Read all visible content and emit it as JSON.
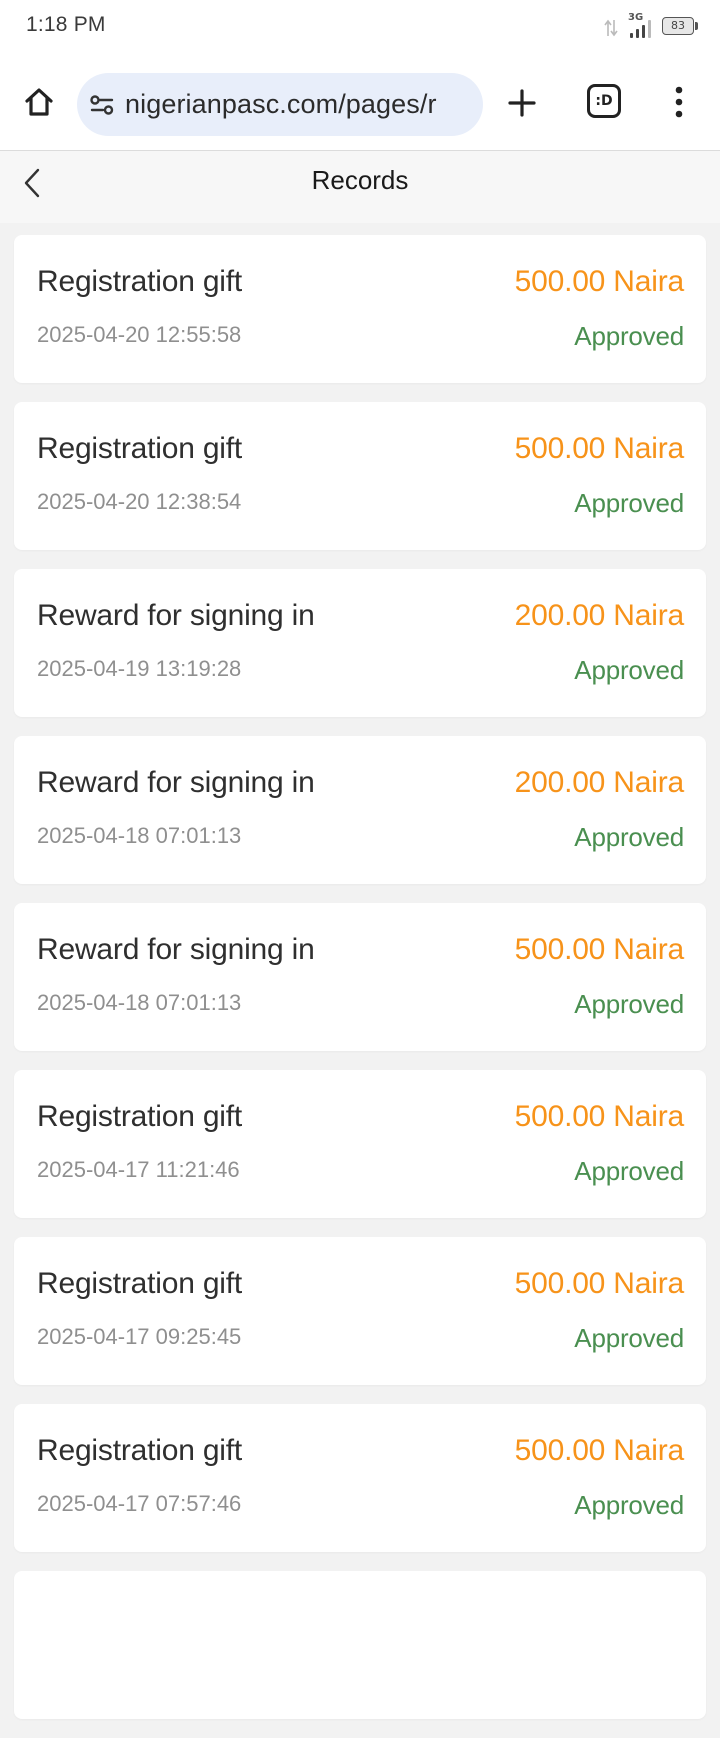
{
  "status_bar": {
    "time": "1:18 PM",
    "network_type": "3G",
    "battery": "83"
  },
  "browser": {
    "url": "nigerianpasc.com/pages/r",
    "tabs_label": ":D"
  },
  "page": {
    "title": "Records"
  },
  "colors": {
    "amount": "#f7931a",
    "approved": "#4a8f50",
    "url_pill": "#e8eefa"
  },
  "records": [
    {
      "title": "Registration gift",
      "time": "2025-04-20 12:55:58",
      "amount": "500.00 Naira",
      "status": "Approved"
    },
    {
      "title": "Registration gift",
      "time": "2025-04-20 12:38:54",
      "amount": "500.00 Naira",
      "status": "Approved"
    },
    {
      "title": "Reward for signing in",
      "time": "2025-04-19 13:19:28",
      "amount": "200.00 Naira",
      "status": "Approved"
    },
    {
      "title": "Reward for signing in",
      "time": "2025-04-18 07:01:13",
      "amount": "200.00 Naira",
      "status": "Approved"
    },
    {
      "title": "Reward for signing in",
      "time": "2025-04-18 07:01:13",
      "amount": "500.00 Naira",
      "status": "Approved"
    },
    {
      "title": "Registration gift",
      "time": "2025-04-17 11:21:46",
      "amount": "500.00 Naira",
      "status": "Approved"
    },
    {
      "title": "Registration gift",
      "time": "2025-04-17 09:25:45",
      "amount": "500.00 Naira",
      "status": "Approved"
    },
    {
      "title": "Registration gift",
      "time": "2025-04-17 07:57:46",
      "amount": "500.00 Naira",
      "status": "Approved"
    }
  ]
}
